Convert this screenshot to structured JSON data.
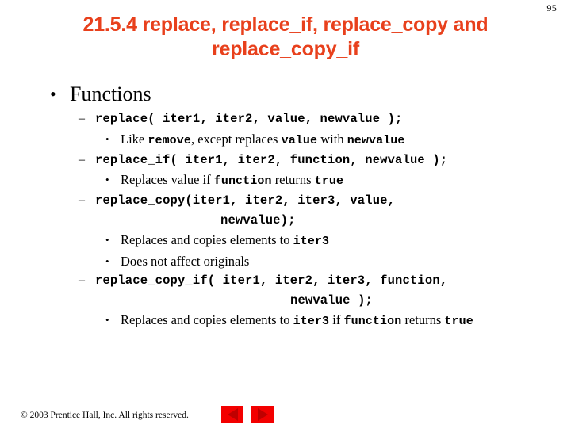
{
  "slide": {
    "page_number": "95",
    "title_lines": [
      "21.5.4 replace, replace_if, replace_copy and",
      "replace_copy_if"
    ],
    "title_color": "#E8401C",
    "section_heading": "Functions",
    "bullet_glyph": "•",
    "dash_glyph": "–",
    "subbullet_glyph": "•",
    "items": [
      {
        "signature": "replace( iter1, iter2, value, newvalue );",
        "continuation": null,
        "notes": [
          {
            "parts": [
              {
                "text": "Like ",
                "code": false
              },
              {
                "text": "remove",
                "code": true
              },
              {
                "text": ", except replaces ",
                "code": false
              },
              {
                "text": "value",
                "code": true
              },
              {
                "text": " with ",
                "code": false
              },
              {
                "text": "newvalue",
                "code": true
              }
            ]
          }
        ]
      },
      {
        "signature": "replace_if( iter1, iter2, function, newvalue );",
        "continuation": null,
        "notes": [
          {
            "parts": [
              {
                "text": "Replaces value if ",
                "code": false
              },
              {
                "text": "function",
                "code": true
              },
              {
                "text": " returns ",
                "code": false
              },
              {
                "text": "true",
                "code": true
              }
            ]
          }
        ]
      },
      {
        "signature": "replace_copy(iter1, iter2, iter3, value,",
        "continuation": "newvalue);",
        "continuation_style": "cont-a",
        "notes": [
          {
            "parts": [
              {
                "text": "Replaces and copies elements to ",
                "code": false
              },
              {
                "text": "iter3",
                "code": true
              }
            ]
          },
          {
            "parts": [
              {
                "text": "Does not affect originals",
                "code": false
              }
            ]
          }
        ]
      },
      {
        "signature": "replace_copy_if( iter1, iter2, iter3, function,",
        "continuation": "newvalue );",
        "continuation_style": "cont-b",
        "notes": [
          {
            "parts": [
              {
                "text": "Replaces and copies elements to ",
                "code": false
              },
              {
                "text": "iter3",
                "code": true
              },
              {
                "text": " if ",
                "code": false
              },
              {
                "text": "function",
                "code": true
              },
              {
                "text": " returns ",
                "code": false
              },
              {
                "text": "true",
                "code": true
              }
            ]
          }
        ]
      }
    ],
    "footer": {
      "copyright": "© 2003 Prentice Hall, Inc.  All rights reserved.",
      "nav_prev_name": "previous-slide",
      "nav_next_name": "next-slide",
      "nav_color": "#F30000"
    }
  }
}
